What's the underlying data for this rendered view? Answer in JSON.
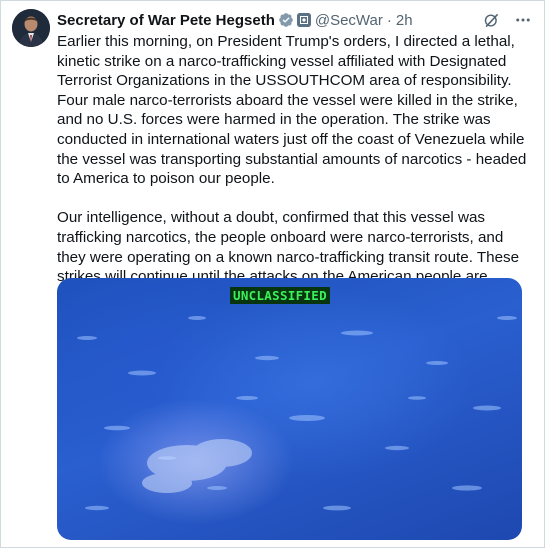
{
  "author": {
    "name": "Secretary of War Pete Hegseth",
    "handle": "@SecWar",
    "separator": "·",
    "time": "2h"
  },
  "icons": {
    "verified": "verified-badge-icon",
    "government": "government-flag-icon",
    "grok": "grok-icon",
    "more": "more-icon"
  },
  "tweet": {
    "paragraph1": "Earlier this morning, on President Trump's orders, I directed a lethal, kinetic strike on a narco-trafficking vessel affiliated with Designated Terrorist Organizations in the USSOUTHCOM area of responsibility. Four male narco-terrorists aboard the vessel were killed in the strike, and no U.S. forces were harmed in the operation. The strike was conducted in international waters just off the coast of Venezuela while the vessel was transporting substantial amounts of narcotics - headed to America to poison our people.",
    "paragraph2": "Our intelligence, without a doubt, confirmed that this vessel was trafficking narcotics, the people onboard were narco-terrorists, and they were operating on a known narco-trafficking transit route. These strikes will continue until the attacks on the American people are over!!!!"
  },
  "media": {
    "overlay_label": "UNCLASSIFIED"
  },
  "colors": {
    "verified": "#829aab",
    "text": "#0f1419",
    "secondary": "#536471",
    "overlay_text": "#3cf05a",
    "water": "#2a5fd0"
  }
}
